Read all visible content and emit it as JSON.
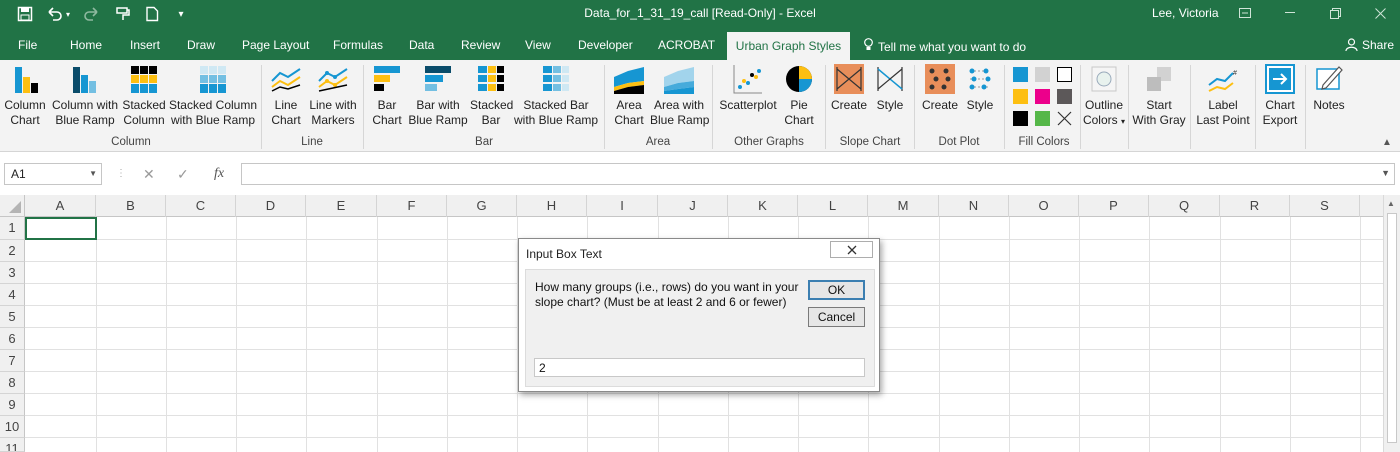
{
  "titlebar": {
    "doc_title": "Data_for_1_31_19_call  [Read-Only]  -  Excel",
    "user": "Lee, Victoria"
  },
  "tabs": {
    "items": [
      "File",
      "Home",
      "Insert",
      "Draw",
      "Page Layout",
      "Formulas",
      "Data",
      "Review",
      "View",
      "Developer",
      "ACROBAT"
    ],
    "active": "Urban Graph Styles",
    "tell_me": "Tell me what you want to do",
    "share": "Share"
  },
  "ribbon": {
    "buttons": {
      "column_chart": [
        "Column",
        "Chart"
      ],
      "column_blue_ramp": [
        "Column with",
        "Blue Ramp"
      ],
      "stacked_column": [
        "Stacked",
        "Column"
      ],
      "stacked_column_blue": [
        "Stacked Column",
        "with Blue Ramp"
      ],
      "line_chart": [
        "Line",
        "Chart"
      ],
      "line_markers": [
        "Line with",
        "Markers"
      ],
      "bar_chart": [
        "Bar",
        "Chart"
      ],
      "bar_blue_ramp": [
        "Bar with",
        "Blue Ramp"
      ],
      "stacked_bar": [
        "Stacked",
        "Bar"
      ],
      "stacked_bar_blue": [
        "Stacked Bar",
        "with Blue Ramp"
      ],
      "area_chart": [
        "Area",
        "Chart"
      ],
      "area_blue_ramp": [
        "Area with",
        "Blue Ramp"
      ],
      "scatterplot": [
        "Scatterplot",
        ""
      ],
      "pie_chart": [
        "Pie",
        "Chart"
      ],
      "slope_create": [
        "Create",
        ""
      ],
      "slope_style": [
        "Style",
        ""
      ],
      "dot_create": [
        "Create",
        ""
      ],
      "dot_style": [
        "Style",
        ""
      ],
      "outline_colors": [
        "Outline",
        "Colors"
      ],
      "start_gray": [
        "Start",
        "With Gray"
      ],
      "label_last": [
        "Label",
        "Last Point"
      ],
      "chart_export": [
        "Chart",
        "Export"
      ],
      "notes": [
        "Notes",
        ""
      ]
    },
    "groups": {
      "column": "Column",
      "line": "Line",
      "bar": "Bar",
      "area": "Area",
      "other": "Other Graphs",
      "slope": "Slope Chart",
      "dot": "Dot Plot",
      "fill": "Fill Colors"
    },
    "colors": {
      "blue": "#1696d2",
      "yellow": "#fdbf11",
      "black": "#000000",
      "gray": "#d2d2d2",
      "magenta": "#ec008b",
      "green": "#55b748",
      "darkgray": "#5c5859",
      "orange": "#e88e5a"
    }
  },
  "formula_bar": {
    "name_box": "A1",
    "fx": "fx"
  },
  "grid": {
    "columns": [
      "A",
      "B",
      "C",
      "D",
      "E",
      "F",
      "G",
      "H",
      "I",
      "J",
      "K",
      "L",
      "M",
      "N",
      "O",
      "P",
      "Q",
      "R",
      "S"
    ],
    "rows": [
      "1",
      "2",
      "3",
      "4",
      "5",
      "6",
      "7",
      "8",
      "9",
      "10",
      "11"
    ]
  },
  "dialog": {
    "title": "Input Box Text",
    "prompt": "How many groups (i.e., rows) do you want in your slope chart? (Must be at least 2 and 6 or fewer)",
    "ok": "OK",
    "cancel": "Cancel",
    "input_value": "2",
    "close_icon": "close-icon"
  }
}
